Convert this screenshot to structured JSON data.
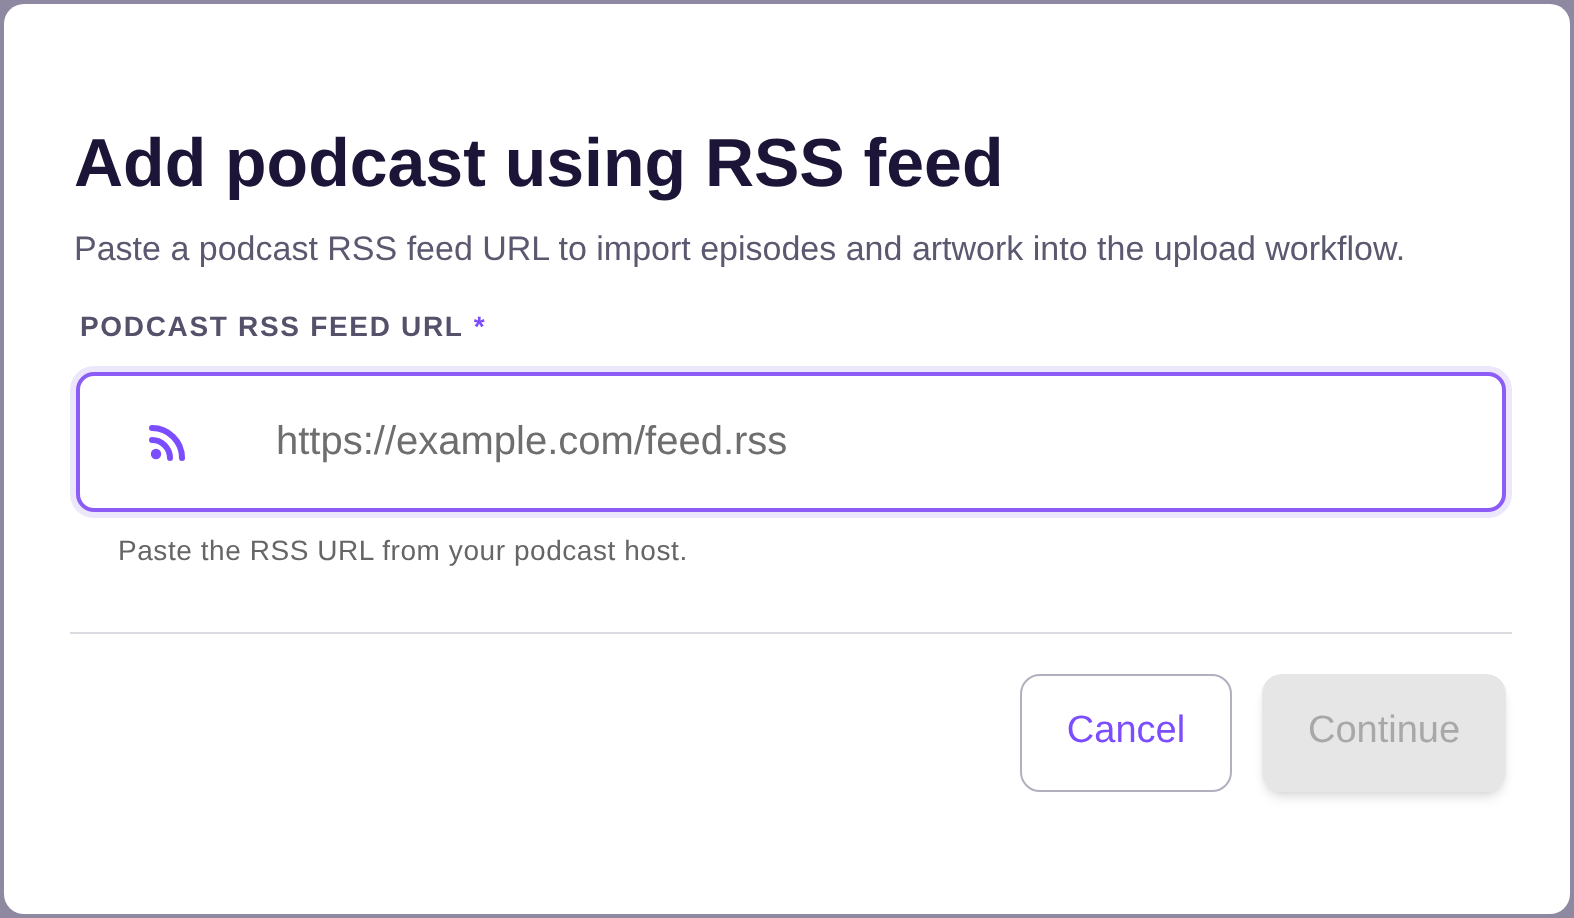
{
  "dialog": {
    "title": "Add podcast using RSS feed",
    "description": "Paste a podcast RSS feed URL to import episodes and artwork into the upload workflow.",
    "field": {
      "label": "PODCAST RSS FEED URL",
      "required": true,
      "required_mark": "*",
      "placeholder": "https://example.com/feed.rss",
      "helper": "Paste the RSS URL from your podcast host.",
      "focused": true
    },
    "buttons": [
      {
        "label": "Cancel",
        "kind": "secondary",
        "disabled": false
      },
      {
        "label": "Continue",
        "kind": "primary",
        "disabled": true
      }
    ]
  }
}
